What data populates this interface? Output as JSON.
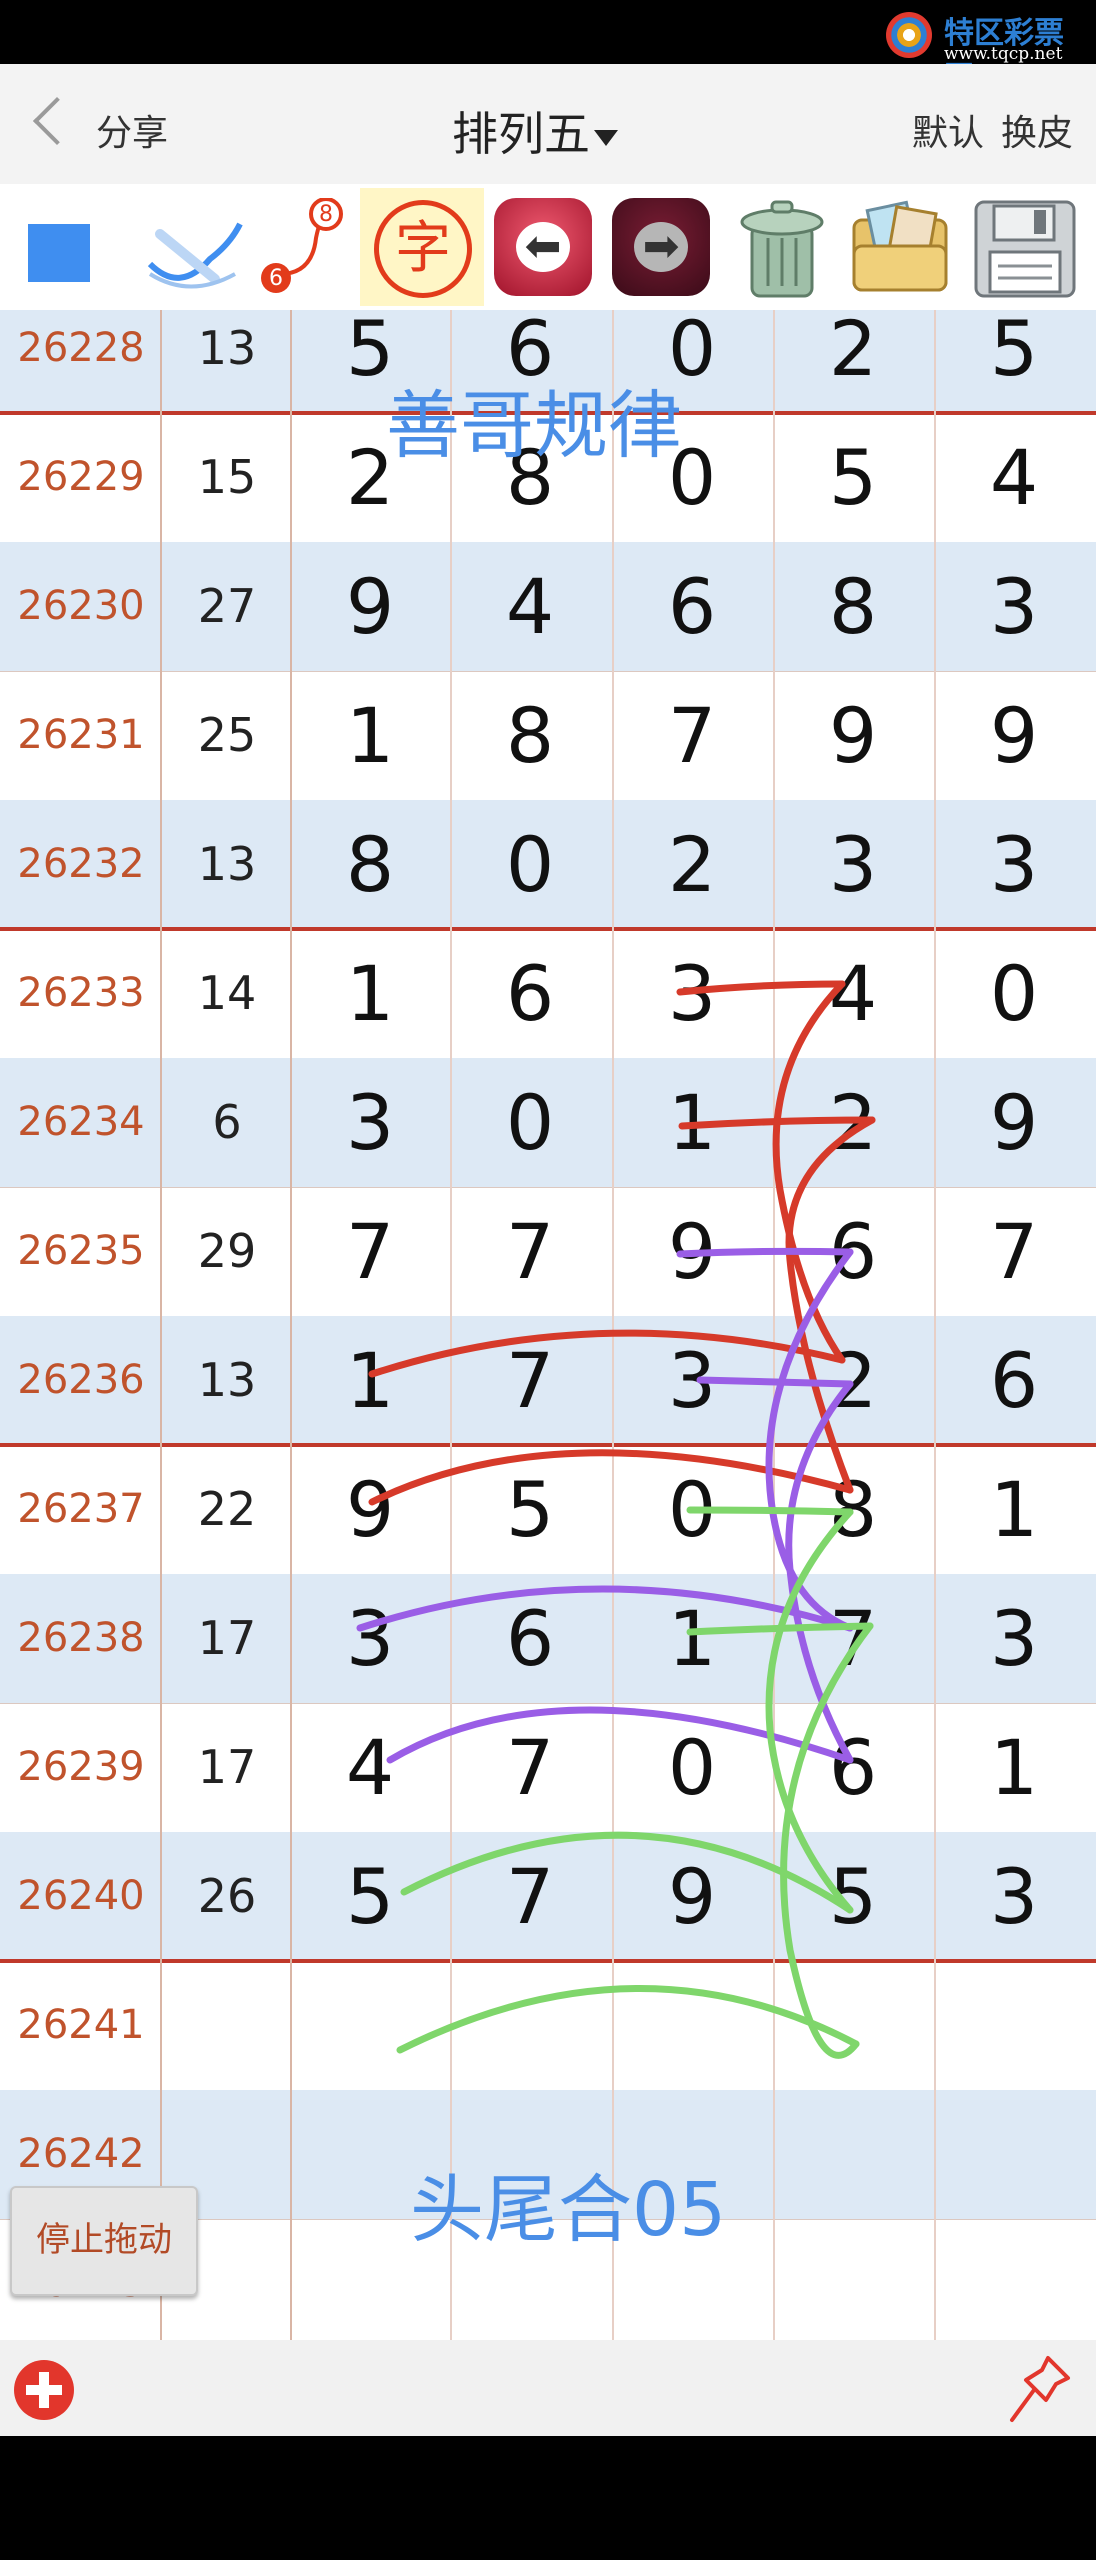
{
  "watermark": {
    "title": "特区彩票网",
    "url": "www.tqcp.net"
  },
  "header": {
    "share": "分享",
    "title": "排列五",
    "default": "默认",
    "skin": "换皮"
  },
  "toolbar": {
    "font_tool": "字",
    "bubble_top": "8",
    "bubble_bottom": "6"
  },
  "annotations": {
    "top": "善哥规律",
    "bottom": "头尾合05"
  },
  "rows": [
    {
      "id": "26228",
      "sum": "13",
      "d": [
        "5",
        "6",
        "0",
        "2",
        "5"
      ]
    },
    {
      "id": "26229",
      "sum": "15",
      "d": [
        "2",
        "8",
        "0",
        "5",
        "4"
      ]
    },
    {
      "id": "26230",
      "sum": "27",
      "d": [
        "9",
        "4",
        "6",
        "8",
        "3"
      ]
    },
    {
      "id": "26231",
      "sum": "25",
      "d": [
        "1",
        "8",
        "7",
        "9",
        "9"
      ]
    },
    {
      "id": "26232",
      "sum": "13",
      "d": [
        "8",
        "0",
        "2",
        "3",
        "3"
      ]
    },
    {
      "id": "26233",
      "sum": "14",
      "d": [
        "1",
        "6",
        "3",
        "4",
        "0"
      ]
    },
    {
      "id": "26234",
      "sum": "6",
      "d": [
        "3",
        "0",
        "1",
        "2",
        "9"
      ]
    },
    {
      "id": "26235",
      "sum": "29",
      "d": [
        "7",
        "7",
        "9",
        "6",
        "7"
      ]
    },
    {
      "id": "26236",
      "sum": "13",
      "d": [
        "1",
        "7",
        "3",
        "2",
        "6"
      ]
    },
    {
      "id": "26237",
      "sum": "22",
      "d": [
        "9",
        "5",
        "0",
        "8",
        "1"
      ]
    },
    {
      "id": "26238",
      "sum": "17",
      "d": [
        "3",
        "6",
        "1",
        "7",
        "3"
      ]
    },
    {
      "id": "26239",
      "sum": "17",
      "d": [
        "4",
        "7",
        "0",
        "6",
        "1"
      ]
    },
    {
      "id": "26240",
      "sum": "26",
      "d": [
        "5",
        "7",
        "9",
        "5",
        "3"
      ]
    },
    {
      "id": "26241",
      "sum": "",
      "d": [
        "",
        "",
        "",
        "",
        ""
      ]
    },
    {
      "id": "26242",
      "sum": "",
      "d": [
        "",
        "",
        "",
        "",
        ""
      ]
    },
    {
      "id": "26243",
      "sum": "",
      "d": [
        "",
        "",
        "",
        "",
        ""
      ]
    }
  ],
  "stop_drag": "停止拖动",
  "colors": {
    "red": "#c0392b",
    "purple": "#9a5ee6",
    "green": "#7fd66b",
    "blue_text": "#4a8ee6"
  }
}
